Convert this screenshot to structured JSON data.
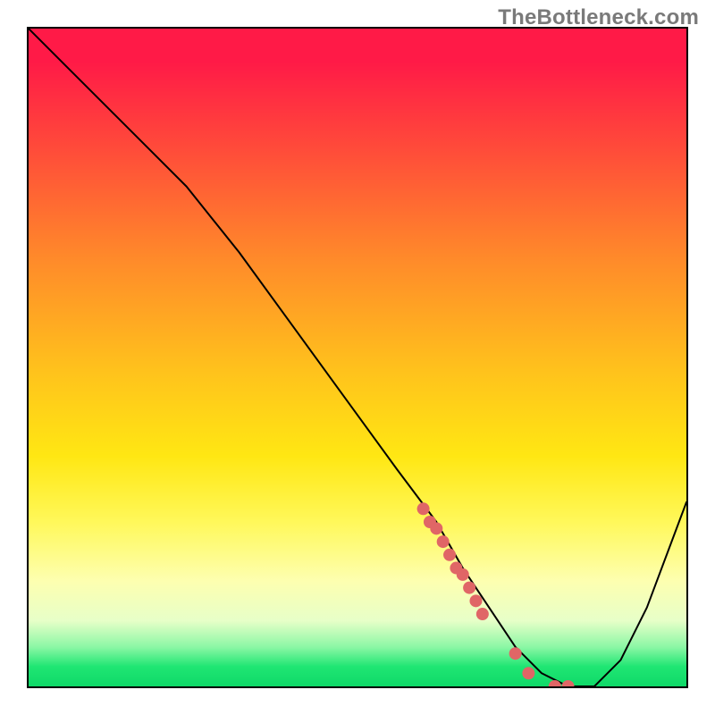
{
  "watermark": "TheBottleneck.com",
  "chart_data": {
    "type": "line",
    "title": "",
    "xlabel": "",
    "ylabel": "",
    "xlim": [
      0,
      100
    ],
    "ylim": [
      0,
      100
    ],
    "series": [
      {
        "name": "curve",
        "x": [
          0,
          6,
          12,
          18,
          24,
          28,
          32,
          40,
          48,
          56,
          62,
          66,
          70,
          74,
          78,
          82,
          86,
          90,
          94,
          100
        ],
        "values": [
          100,
          94,
          88,
          82,
          76,
          71,
          66,
          55,
          44,
          33,
          25,
          18,
          12,
          6,
          2,
          0,
          0,
          4,
          12,
          28
        ]
      }
    ],
    "markers": {
      "name": "highlight-dots",
      "color": "#e06666",
      "x": [
        60,
        61,
        62,
        63,
        64,
        65,
        66,
        67,
        68,
        69,
        74,
        76,
        80,
        82
      ],
      "values": [
        27,
        25,
        24,
        22,
        20,
        18,
        17,
        15,
        13,
        11,
        5,
        2,
        0,
        0
      ]
    }
  },
  "colors": {
    "curve": "#000000",
    "marker": "#e06666",
    "frame": "#000000"
  }
}
